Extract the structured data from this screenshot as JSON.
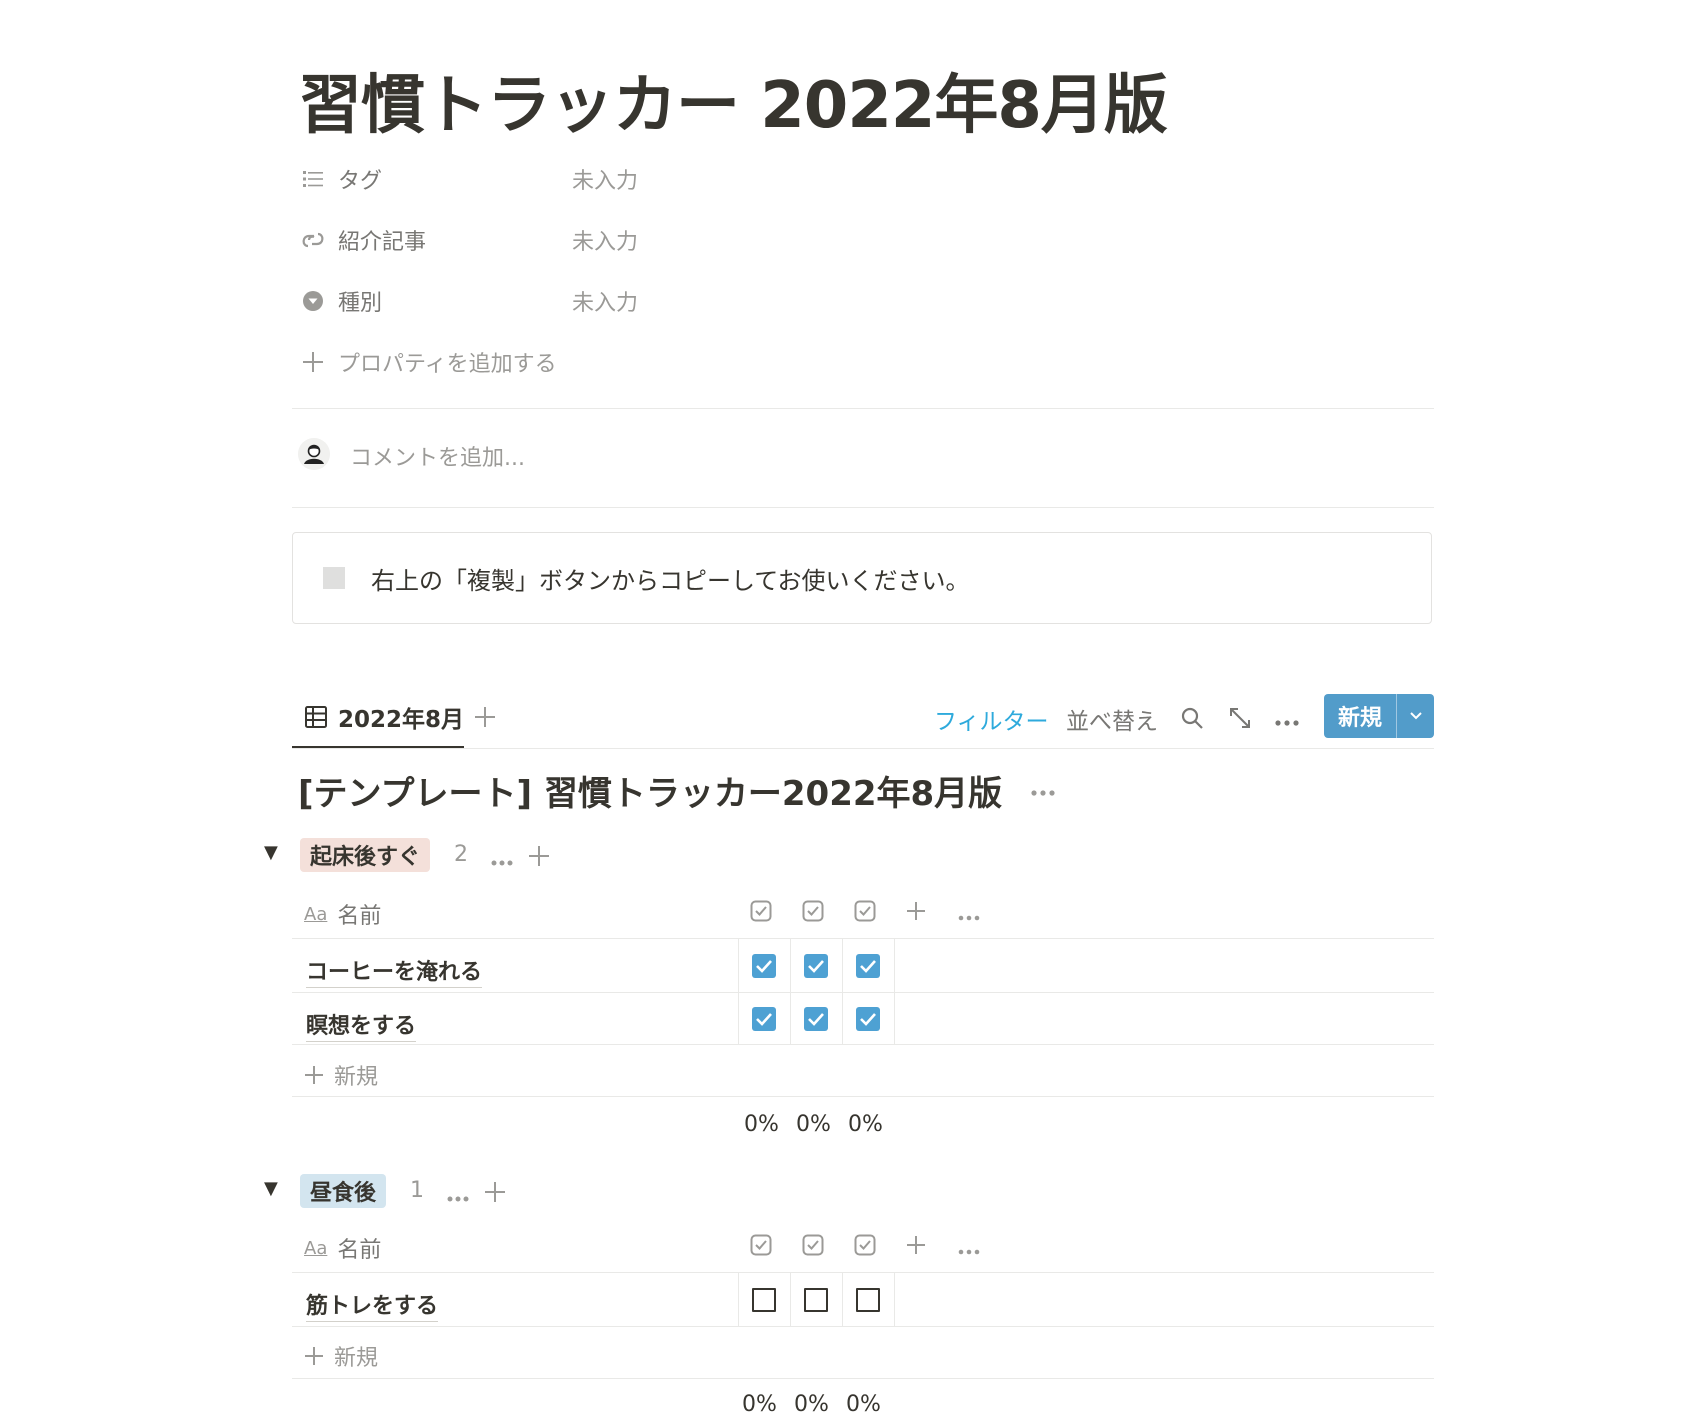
{
  "page": {
    "title": "習慣トラッカー 2022年8月版",
    "properties": [
      {
        "label": "タグ",
        "icon": "list-icon",
        "value": "未入力"
      },
      {
        "label": "紹介記事",
        "icon": "relation-icon",
        "value": "未入力"
      },
      {
        "label": "種別",
        "icon": "select-icon",
        "value": "未入力"
      }
    ],
    "add_property": "プロパティを追加する",
    "comment_placeholder": "コメントを追加...",
    "callout_text": "右上の「複製」ボタンからコピーしてお使いください。"
  },
  "database": {
    "view_tab": "2022年8月",
    "toolbar": {
      "filter": "フィルター",
      "sort": "並べ替え",
      "new": "新規"
    },
    "colors": {
      "accent": "#529cca",
      "checkbox": "#4ea1d3",
      "link": "#2eaadc"
    },
    "title": "[テンプレート] 習慣トラッカー2022年8月版",
    "name_column": "名前",
    "name_column_icon": "Aa",
    "new_row_label": "新規",
    "groups": [
      {
        "name": "起床後すぐ",
        "color": "#f4e0da",
        "count": "2",
        "rows": [
          {
            "name": "コーヒーを淹れる",
            "checks": [
              true,
              true,
              true
            ]
          },
          {
            "name": "瞑想をする",
            "checks": [
              true,
              true,
              true
            ]
          }
        ],
        "calcs": [
          "0%",
          "0%",
          "0%"
        ]
      },
      {
        "name": "昼食後",
        "color": "#d3e5ef",
        "count": "1",
        "rows": [
          {
            "name": "筋トレをする",
            "checks": [
              false,
              false,
              false
            ]
          }
        ],
        "calcs": [
          "0%",
          "0%",
          "0%"
        ]
      }
    ]
  }
}
